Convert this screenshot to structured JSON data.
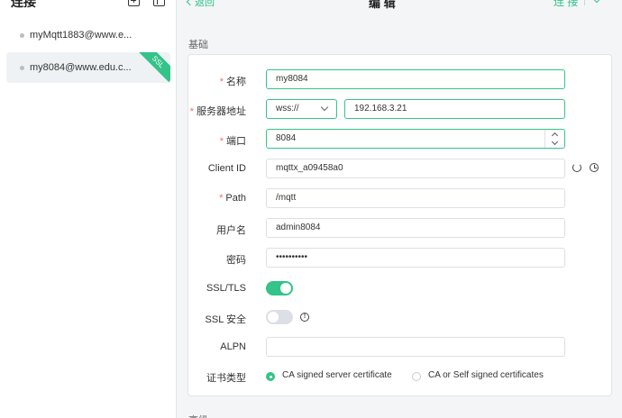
{
  "sidebar": {
    "title": "连接",
    "connections": [
      {
        "name": "myMqtt1883@www.e...",
        "ssl": false
      },
      {
        "name": "my8084@www.edu.c...",
        "ssl": true,
        "badge": "SSL"
      }
    ]
  },
  "topbar": {
    "back_label": "返回",
    "title": "编 辑",
    "connect_label": "连 接"
  },
  "section": {
    "basic_label": "基础",
    "next_label": "高级"
  },
  "form": {
    "name": {
      "label": "名称",
      "required": "*",
      "value": "my8084"
    },
    "host": {
      "label": "服务器地址",
      "required": "*",
      "protocol": "wss://",
      "value": "192.168.3.21"
    },
    "port": {
      "label": "端口",
      "required": "*",
      "value": "8084"
    },
    "client_id": {
      "label": "Client ID",
      "value": "mqttx_a09458a0"
    },
    "path": {
      "label": "Path",
      "required": "*",
      "value": "/mqtt"
    },
    "username": {
      "label": "用户名",
      "value": "admin8084"
    },
    "password": {
      "label": "密码",
      "value": "••••••••••"
    },
    "ssl_tls": {
      "label": "SSL/TLS",
      "enabled": true
    },
    "ssl_secure": {
      "label": "SSL 安全",
      "enabled": false,
      "info_glyph": "!"
    },
    "alpn": {
      "label": "ALPN",
      "value": ""
    },
    "cert_type": {
      "label": "证书类型",
      "options": [
        "CA signed server certificate",
        "CA or Self signed certificates"
      ],
      "selected": "CA signed server certificate"
    }
  },
  "colors": {
    "accent": "#34c388",
    "required": "#f56c6c"
  },
  "icons": [
    "add-icon",
    "layout-icon",
    "chevron-left-icon",
    "chevron-down-icon",
    "refresh-icon",
    "clock-icon",
    "info-icon"
  ]
}
